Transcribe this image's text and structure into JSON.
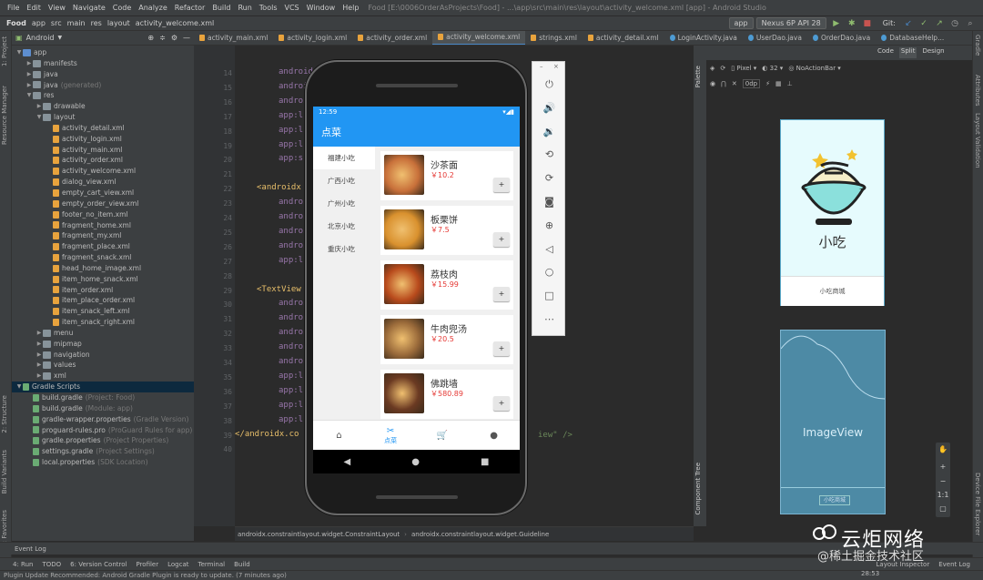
{
  "menu": {
    "items": [
      "File",
      "Edit",
      "View",
      "Navigate",
      "Code",
      "Analyze",
      "Refactor",
      "Build",
      "Run",
      "Tools",
      "VCS",
      "Window",
      "Help"
    ],
    "window_title": "Food [E:\\0006OrderAsProjects\\Food] - ...\\app\\src\\main\\res\\layout\\activity_welcome.xml [app] - Android Studio"
  },
  "toolbar": {
    "breadcrumb": [
      "Food",
      "app",
      "src",
      "main",
      "res",
      "layout",
      "activity_welcome.xml"
    ],
    "run_config": "app",
    "device": "Nexus 6P API 28",
    "git_label": "Git:"
  },
  "project": {
    "view_label": "Android",
    "tree": [
      {
        "label": "app",
        "type": "folder",
        "level": 0,
        "open": true
      },
      {
        "label": "manifests",
        "type": "folder",
        "level": 1,
        "open": false
      },
      {
        "label": "java",
        "type": "folder",
        "level": 1,
        "open": false
      },
      {
        "label": "java",
        "sub": "(generated)",
        "type": "folder",
        "level": 1,
        "open": false
      },
      {
        "label": "res",
        "type": "folder",
        "level": 1,
        "open": true
      },
      {
        "label": "drawable",
        "type": "folder",
        "level": 2,
        "open": false
      },
      {
        "label": "layout",
        "type": "folder",
        "level": 2,
        "open": true
      },
      {
        "label": "activity_detail.xml",
        "type": "xml",
        "level": 3
      },
      {
        "label": "activity_login.xml",
        "type": "xml",
        "level": 3
      },
      {
        "label": "activity_main.xml",
        "type": "xml",
        "level": 3
      },
      {
        "label": "activity_order.xml",
        "type": "xml",
        "level": 3
      },
      {
        "label": "activity_welcome.xml",
        "type": "xml",
        "level": 3
      },
      {
        "label": "dialog_view.xml",
        "type": "xml",
        "level": 3
      },
      {
        "label": "empty_cart_view.xml",
        "type": "xml",
        "level": 3
      },
      {
        "label": "empty_order_view.xml",
        "type": "xml",
        "level": 3
      },
      {
        "label": "footer_no_item.xml",
        "type": "xml",
        "level": 3
      },
      {
        "label": "fragment_home.xml",
        "type": "xml",
        "level": 3
      },
      {
        "label": "fragment_my.xml",
        "type": "xml",
        "level": 3
      },
      {
        "label": "fragment_place.xml",
        "type": "xml",
        "level": 3
      },
      {
        "label": "fragment_snack.xml",
        "type": "xml",
        "level": 3
      },
      {
        "label": "head_home_image.xml",
        "type": "xml",
        "level": 3
      },
      {
        "label": "item_home_snack.xml",
        "type": "xml",
        "level": 3
      },
      {
        "label": "item_order.xml",
        "type": "xml",
        "level": 3
      },
      {
        "label": "item_place_order.xml",
        "type": "xml",
        "level": 3
      },
      {
        "label": "item_snack_left.xml",
        "type": "xml",
        "level": 3
      },
      {
        "label": "item_snack_right.xml",
        "type": "xml",
        "level": 3
      },
      {
        "label": "menu",
        "type": "folder",
        "level": 2,
        "open": false
      },
      {
        "label": "mipmap",
        "type": "folder",
        "level": 2,
        "open": false
      },
      {
        "label": "navigation",
        "type": "folder",
        "level": 2,
        "open": false
      },
      {
        "label": "values",
        "type": "folder",
        "level": 2,
        "open": false
      },
      {
        "label": "xml",
        "type": "folder",
        "level": 2,
        "open": false
      },
      {
        "label": "Gradle Scripts",
        "type": "gradle-root",
        "level": 0,
        "open": true
      },
      {
        "label": "build.gradle",
        "sub": "(Project: Food)",
        "type": "gradle",
        "level": 1
      },
      {
        "label": "build.gradle",
        "sub": "(Module: app)",
        "type": "gradle",
        "level": 1
      },
      {
        "label": "gradle-wrapper.properties",
        "sub": "(Gradle Version)",
        "type": "gradle",
        "level": 1
      },
      {
        "label": "proguard-rules.pro",
        "sub": "(ProGuard Rules for app)",
        "type": "gradle",
        "level": 1
      },
      {
        "label": "gradle.properties",
        "sub": "(Project Properties)",
        "type": "gradle",
        "level": 1
      },
      {
        "label": "settings.gradle",
        "sub": "(Project Settings)",
        "type": "gradle",
        "level": 1
      },
      {
        "label": "local.properties",
        "sub": "(SDK Location)",
        "type": "gradle",
        "level": 1
      }
    ]
  },
  "editor_tabs": [
    {
      "label": "activity_main.xml",
      "type": "xml",
      "active": false
    },
    {
      "label": "activity_login.xml",
      "type": "xml",
      "active": false
    },
    {
      "label": "activity_order.xml",
      "type": "xml",
      "active": false
    },
    {
      "label": "activity_welcome.xml",
      "type": "xml",
      "active": true
    },
    {
      "label": "strings.xml",
      "type": "xml",
      "active": false
    },
    {
      "label": "activity_detail.xml",
      "type": "xml",
      "active": false
    },
    {
      "label": "LoginActivity.java",
      "type": "java",
      "active": false
    },
    {
      "label": "UserDao.java",
      "type": "java",
      "active": false
    },
    {
      "label": "OrderDao.java",
      "type": "java",
      "active": false
    },
    {
      "label": "DatabaseHelp...",
      "type": "java",
      "active": false
    }
  ],
  "code": {
    "line_numbers": [
      "14",
      "15",
      "16",
      "17",
      "18",
      "19",
      "20",
      "21",
      "22",
      "23",
      "24",
      "25",
      "26",
      "27",
      "28",
      "29",
      "30",
      "31",
      "32",
      "33",
      "34",
      "35",
      "36",
      "37",
      "38",
      "39",
      "40"
    ],
    "lines": [
      {
        "text": "android",
        "cls": ""
      },
      {
        "text": "android",
        "cls": ""
      },
      {
        "text": "android",
        "cls": ""
      },
      {
        "text": "app:l",
        "cls": ""
      },
      {
        "text": "app:l",
        "cls": ""
      },
      {
        "text": "app:l",
        "cls": ""
      },
      {
        "text": "app:s",
        "cls": ""
      },
      {
        "text": "",
        "cls": ""
      },
      {
        "text": "<androidx",
        "cls": "tag"
      },
      {
        "text": "android",
        "cls": ""
      },
      {
        "text": "android",
        "cls": ""
      },
      {
        "text": "android",
        "cls": ""
      },
      {
        "text": "android",
        "cls": ""
      },
      {
        "text": "app:l",
        "cls": ""
      },
      {
        "text": "",
        "cls": ""
      },
      {
        "text": "<TextView",
        "cls": "tag"
      },
      {
        "text": "android",
        "cls": ""
      },
      {
        "text": "android",
        "cls": ""
      },
      {
        "text": "android",
        "cls": ""
      },
      {
        "text": "android",
        "cls": ""
      },
      {
        "text": "android",
        "cls": ""
      },
      {
        "text": "app:l",
        "cls": ""
      },
      {
        "text": "app:l",
        "cls": ""
      },
      {
        "text": "app:l",
        "cls": ""
      },
      {
        "text": "app:l",
        "cls": ""
      },
      {
        "text": "</androidx.co",
        "cls": "tag"
      }
    ],
    "trailing_text": "iew\" />"
  },
  "breadcrumb_bar": [
    "androidx.constraintlayout.widget.ConstraintLayout",
    "androidx.constraintlayout.widget.Guideline"
  ],
  "phone": {
    "status_time": "12:59",
    "app_title": "点菜",
    "categories": [
      "福建小吃",
      "广西小吃",
      "广州小吃",
      "北京小吃",
      "重庆小吃"
    ],
    "foods": [
      {
        "name": "沙茶面",
        "price": "￥10.2",
        "img": "#c8703a",
        "add": "+"
      },
      {
        "name": "板栗饼",
        "price": "￥7.5",
        "img": "#d9912e",
        "add": "+"
      },
      {
        "name": "荔枝肉",
        "price": "￥15.99",
        "img": "#b84a1c",
        "add": "+"
      },
      {
        "name": "牛肉兜汤",
        "price": "￥20.5",
        "img": "#9a6a3a",
        "add": "+"
      },
      {
        "name": "佛跳墙",
        "price": "￥580.89",
        "img": "#6b3a22",
        "add": "+"
      }
    ],
    "bottom_nav": [
      {
        "icon": "home-icon",
        "glyph": "⌂",
        "label": ""
      },
      {
        "icon": "order-icon",
        "glyph": "✂",
        "label": "点菜"
      },
      {
        "icon": "cart-icon",
        "glyph": "🛒",
        "label": ""
      },
      {
        "icon": "user-icon",
        "glyph": "●",
        "label": ""
      }
    ],
    "nav_back": "◀",
    "nav_home": "●",
    "nav_recent": "■"
  },
  "emulator_controls": [
    {
      "icon": "power-icon",
      "glyph": "⏻"
    },
    {
      "icon": "volume-up-icon",
      "glyph": "🔊"
    },
    {
      "icon": "volume-down-icon",
      "glyph": "🔉"
    },
    {
      "icon": "rotate-left-icon",
      "glyph": "⟲"
    },
    {
      "icon": "rotate-right-icon",
      "glyph": "⟳"
    },
    {
      "icon": "camera-icon",
      "glyph": "◙"
    },
    {
      "icon": "zoom-icon",
      "glyph": "⊕"
    },
    {
      "icon": "back-icon",
      "glyph": "◁"
    },
    {
      "icon": "home-icon",
      "glyph": "○"
    },
    {
      "icon": "overview-icon",
      "glyph": "□"
    },
    {
      "icon": "more-icon",
      "glyph": "⋯"
    }
  ],
  "design": {
    "buttons": [
      "Code",
      "Split",
      "Design"
    ],
    "device_select": "Pixel",
    "api_select": "32",
    "theme_select": "NoActionBar",
    "margin_label": "0dp",
    "palette_label": "Palette",
    "component_tree_label": "Component Tree",
    "preview1_title": "小吃",
    "preview1_footer": "小吃商城",
    "preview2_label": "ImageView",
    "preview2_button": "小吃商城",
    "zoom_ratio": "1:1"
  },
  "sidebar_labels": {
    "project": "1: Project",
    "resource_manager": "Resource Manager",
    "structure": "2: Structure",
    "build_variants": "Build Variants",
    "favorites": "2: Favorites",
    "gradle": "Gradle",
    "attributes": "Attributes",
    "layout_validation": "Layout Validation",
    "device_file_explorer": "Device File Explorer"
  },
  "event_log_tab": "Event Log",
  "bottom_tools": [
    "4: Run",
    "TODO",
    "6: Version Control",
    "Profiler",
    "Logcat",
    "Terminal",
    "Build"
  ],
  "bottom_right": [
    "Layout Inspector",
    "Event Log"
  ],
  "status_message": "Plugin Update Recommended: Android Gradle Plugin is ready to update. (7 minutes ago)",
  "clock": "28:53",
  "watermark": {
    "title": "云炬网络",
    "subtitle": "@稀土掘金技术社区"
  }
}
